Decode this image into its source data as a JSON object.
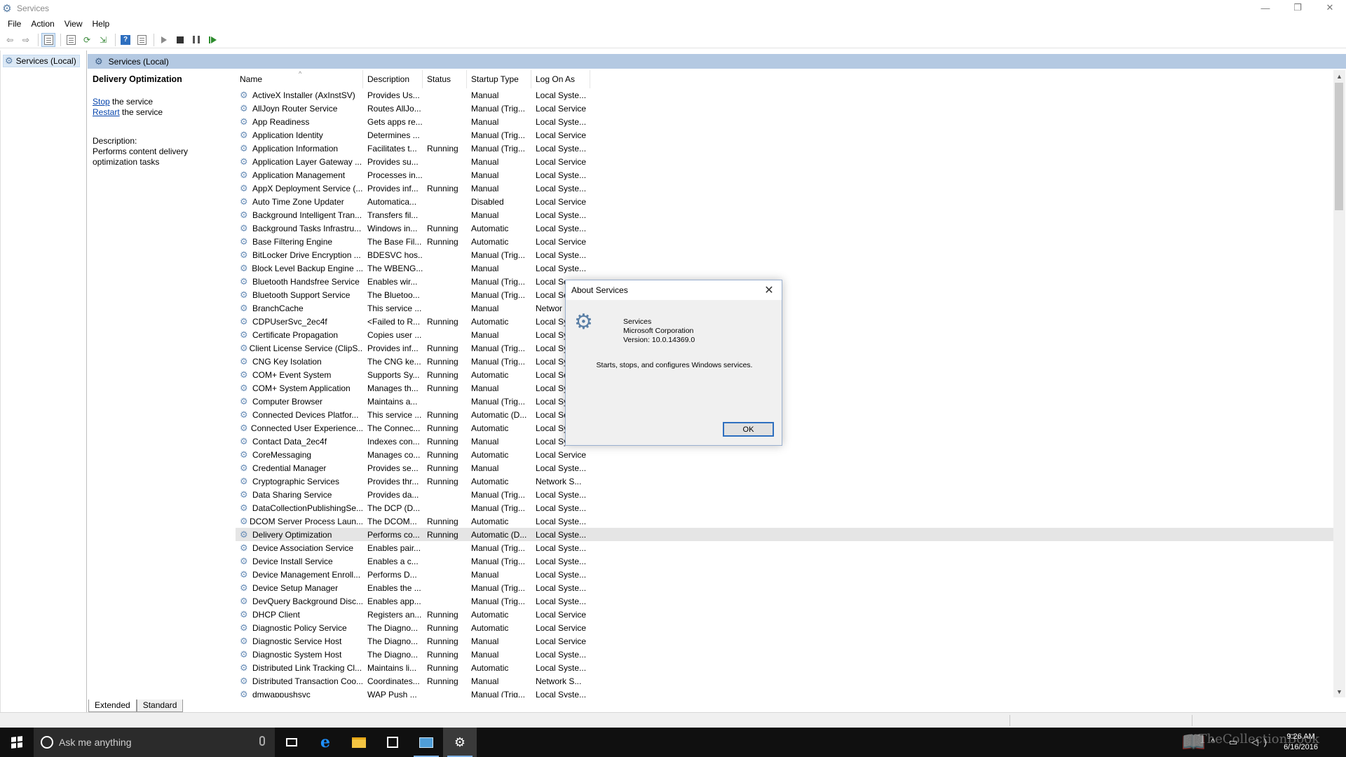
{
  "window": {
    "title": "Services",
    "controls": {
      "minimize": "—",
      "restore": "❐",
      "close": "✕"
    }
  },
  "menu": [
    "File",
    "Action",
    "View",
    "Help"
  ],
  "tree": {
    "root_label": "Services (Local)"
  },
  "main_header": {
    "label": "Services (Local)"
  },
  "details": {
    "service_name": "Delivery Optimization",
    "stop_link": "Stop",
    "stop_suffix": " the service",
    "restart_link": "Restart",
    "restart_suffix": " the service",
    "description_label": "Description:",
    "description_text": "Performs content delivery optimization tasks"
  },
  "columns": [
    "Name",
    "Description",
    "Status",
    "Startup Type",
    "Log On As"
  ],
  "services": [
    {
      "name": "ActiveX Installer (AxInstSV)",
      "desc": "Provides Us...",
      "status": "",
      "startup": "Manual",
      "logon": "Local Syste..."
    },
    {
      "name": "AllJoyn Router Service",
      "desc": "Routes AllJo...",
      "status": "",
      "startup": "Manual (Trig...",
      "logon": "Local Service"
    },
    {
      "name": "App Readiness",
      "desc": "Gets apps re...",
      "status": "",
      "startup": "Manual",
      "logon": "Local Syste..."
    },
    {
      "name": "Application Identity",
      "desc": "Determines ...",
      "status": "",
      "startup": "Manual (Trig...",
      "logon": "Local Service"
    },
    {
      "name": "Application Information",
      "desc": "Facilitates t...",
      "status": "Running",
      "startup": "Manual (Trig...",
      "logon": "Local Syste..."
    },
    {
      "name": "Application Layer Gateway ...",
      "desc": "Provides su...",
      "status": "",
      "startup": "Manual",
      "logon": "Local Service"
    },
    {
      "name": "Application Management",
      "desc": "Processes in...",
      "status": "",
      "startup": "Manual",
      "logon": "Local Syste..."
    },
    {
      "name": "AppX Deployment Service (...",
      "desc": "Provides inf...",
      "status": "Running",
      "startup": "Manual",
      "logon": "Local Syste..."
    },
    {
      "name": "Auto Time Zone Updater",
      "desc": "Automatica...",
      "status": "",
      "startup": "Disabled",
      "logon": "Local Service"
    },
    {
      "name": "Background Intelligent Tran...",
      "desc": "Transfers fil...",
      "status": "",
      "startup": "Manual",
      "logon": "Local Syste..."
    },
    {
      "name": "Background Tasks Infrastru...",
      "desc": "Windows in...",
      "status": "Running",
      "startup": "Automatic",
      "logon": "Local Syste..."
    },
    {
      "name": "Base Filtering Engine",
      "desc": "The Base Fil...",
      "status": "Running",
      "startup": "Automatic",
      "logon": "Local Service"
    },
    {
      "name": "BitLocker Drive Encryption ...",
      "desc": "BDESVC hos...",
      "status": "",
      "startup": "Manual (Trig...",
      "logon": "Local Syste..."
    },
    {
      "name": "Block Level Backup Engine ...",
      "desc": "The WBENG...",
      "status": "",
      "startup": "Manual",
      "logon": "Local Syste..."
    },
    {
      "name": "Bluetooth Handsfree Service",
      "desc": "Enables wir...",
      "status": "",
      "startup": "Manual (Trig...",
      "logon": "Local Se"
    },
    {
      "name": "Bluetooth Support Service",
      "desc": "The Bluetoo...",
      "status": "",
      "startup": "Manual (Trig...",
      "logon": "Local Se"
    },
    {
      "name": "BranchCache",
      "desc": "This service ...",
      "status": "",
      "startup": "Manual",
      "logon": "Networ"
    },
    {
      "name": "CDPUserSvc_2ec4f",
      "desc": "<Failed to R...",
      "status": "Running",
      "startup": "Automatic",
      "logon": "Local Sy"
    },
    {
      "name": "Certificate Propagation",
      "desc": "Copies user ...",
      "status": "",
      "startup": "Manual",
      "logon": "Local Sy"
    },
    {
      "name": "Client License Service (ClipS...",
      "desc": "Provides inf...",
      "status": "Running",
      "startup": "Manual (Trig...",
      "logon": "Local Sy"
    },
    {
      "name": "CNG Key Isolation",
      "desc": "The CNG ke...",
      "status": "Running",
      "startup": "Manual (Trig...",
      "logon": "Local Sy"
    },
    {
      "name": "COM+ Event System",
      "desc": "Supports Sy...",
      "status": "Running",
      "startup": "Automatic",
      "logon": "Local Se"
    },
    {
      "name": "COM+ System Application",
      "desc": "Manages th...",
      "status": "Running",
      "startup": "Manual",
      "logon": "Local Sy"
    },
    {
      "name": "Computer Browser",
      "desc": "Maintains a...",
      "status": "",
      "startup": "Manual (Trig...",
      "logon": "Local Sy"
    },
    {
      "name": "Connected Devices Platfor...",
      "desc": "This service ...",
      "status": "Running",
      "startup": "Automatic (D...",
      "logon": "Local Se"
    },
    {
      "name": "Connected User Experience...",
      "desc": "The Connec...",
      "status": "Running",
      "startup": "Automatic",
      "logon": "Local Sy"
    },
    {
      "name": "Contact Data_2ec4f",
      "desc": "Indexes con...",
      "status": "Running",
      "startup": "Manual",
      "logon": "Local Sy"
    },
    {
      "name": "CoreMessaging",
      "desc": "Manages co...",
      "status": "Running",
      "startup": "Automatic",
      "logon": "Local Service"
    },
    {
      "name": "Credential Manager",
      "desc": "Provides se...",
      "status": "Running",
      "startup": "Manual",
      "logon": "Local Syste..."
    },
    {
      "name": "Cryptographic Services",
      "desc": "Provides thr...",
      "status": "Running",
      "startup": "Automatic",
      "logon": "Network S..."
    },
    {
      "name": "Data Sharing Service",
      "desc": "Provides da...",
      "status": "",
      "startup": "Manual (Trig...",
      "logon": "Local Syste..."
    },
    {
      "name": "DataCollectionPublishingSe...",
      "desc": "The DCP (D...",
      "status": "",
      "startup": "Manual (Trig...",
      "logon": "Local Syste..."
    },
    {
      "name": "DCOM Server Process Laun...",
      "desc": "The DCOM...",
      "status": "Running",
      "startup": "Automatic",
      "logon": "Local Syste..."
    },
    {
      "name": "Delivery Optimization",
      "desc": "Performs co...",
      "status": "Running",
      "startup": "Automatic (D...",
      "logon": "Local Syste..."
    },
    {
      "name": "Device Association Service",
      "desc": "Enables pair...",
      "status": "",
      "startup": "Manual (Trig...",
      "logon": "Local Syste..."
    },
    {
      "name": "Device Install Service",
      "desc": "Enables a c...",
      "status": "",
      "startup": "Manual (Trig...",
      "logon": "Local Syste..."
    },
    {
      "name": "Device Management Enroll...",
      "desc": "Performs D...",
      "status": "",
      "startup": "Manual",
      "logon": "Local Syste..."
    },
    {
      "name": "Device Setup Manager",
      "desc": "Enables the ...",
      "status": "",
      "startup": "Manual (Trig...",
      "logon": "Local Syste..."
    },
    {
      "name": "DevQuery Background Disc...",
      "desc": "Enables app...",
      "status": "",
      "startup": "Manual (Trig...",
      "logon": "Local Syste..."
    },
    {
      "name": "DHCP Client",
      "desc": "Registers an...",
      "status": "Running",
      "startup": "Automatic",
      "logon": "Local Service"
    },
    {
      "name": "Diagnostic Policy Service",
      "desc": "The Diagno...",
      "status": "Running",
      "startup": "Automatic",
      "logon": "Local Service"
    },
    {
      "name": "Diagnostic Service Host",
      "desc": "The Diagno...",
      "status": "Running",
      "startup": "Manual",
      "logon": "Local Service"
    },
    {
      "name": "Diagnostic System Host",
      "desc": "The Diagno...",
      "status": "Running",
      "startup": "Manual",
      "logon": "Local Syste..."
    },
    {
      "name": "Distributed Link Tracking Cl...",
      "desc": "Maintains li...",
      "status": "Running",
      "startup": "Automatic",
      "logon": "Local Syste..."
    },
    {
      "name": "Distributed Transaction Coo...",
      "desc": "Coordinates...",
      "status": "Running",
      "startup": "Manual",
      "logon": "Network S..."
    },
    {
      "name": "dmwappushsvc",
      "desc": "WAP Push ...",
      "status": "",
      "startup": "Manual (Trig...",
      "logon": "Local Syste..."
    }
  ],
  "selected_service": "Delivery Optimization",
  "tabs": [
    "Extended",
    "Standard"
  ],
  "dialog": {
    "title": "About Services",
    "product": "Services",
    "company": "Microsoft Corporation",
    "version": "Version: 10.0.14369.0",
    "text": "Starts, stops, and configures Windows services.",
    "ok_label": "OK"
  },
  "taskbar": {
    "search_placeholder": "Ask me anything",
    "time": "9:26 AM",
    "date": "6/16/2016",
    "watermark": "TheCollectionBook"
  },
  "colors": {
    "header_band": "#b4c9e2",
    "selection": "#dbe8f5",
    "taskbar": "#101010",
    "link": "#0645ad",
    "dialog_ok_border": "#2e6fbf"
  }
}
